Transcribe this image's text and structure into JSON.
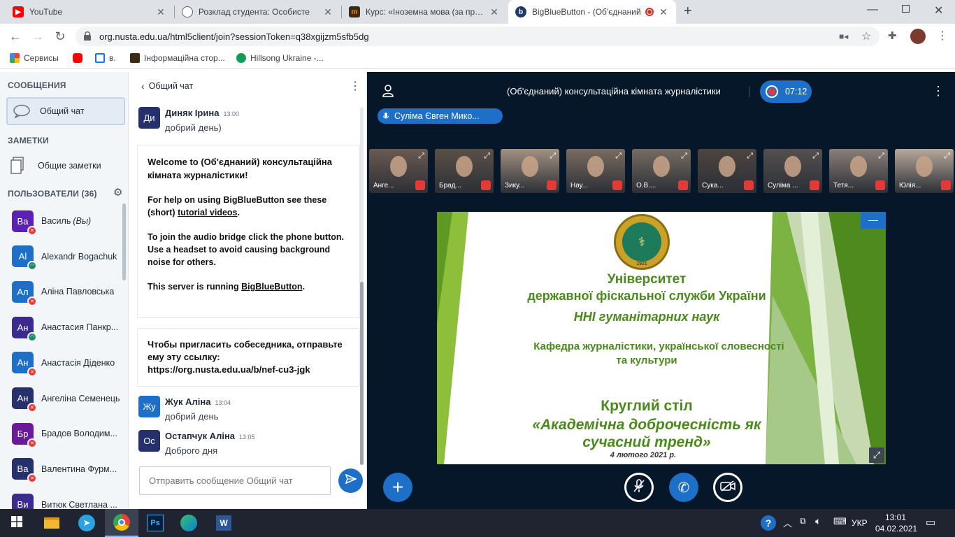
{
  "browser": {
    "tabs": [
      {
        "title": "YouTube",
        "icon": "youtube-icon",
        "color": "#ff0000"
      },
      {
        "title": "Розклад студента: Особисте",
        "icon": "globe-icon",
        "color": "#5f6368"
      },
      {
        "title": "Курс: «Іноземна мова (за профе",
        "icon": "moodle-icon",
        "color": "#f98012"
      },
      {
        "title": "BigBlueButton - (Об'єднаний",
        "icon": "bbb-icon",
        "color": "#1a73e8",
        "active": true
      }
    ],
    "url": "org.nusta.edu.ua/html5client/join?sessionToken=q38xgijzm5sfb5dg",
    "bookmarks": [
      "Сервисы",
      "",
      "в.",
      "Інформаційна стор...",
      "Hillsong Ukraine -..."
    ]
  },
  "sidebar": {
    "messages_heading": "СООБЩЕНИЯ",
    "public_chat": "Общий чат",
    "notes_heading": "ЗАМЕТКИ",
    "shared_notes": "Общие заметки",
    "users_heading": "ПОЛЬЗОВАТЕЛИ (36)",
    "users": [
      {
        "initials": "Ва",
        "name": "Василь",
        "suffix": "(Вы)",
        "color": "#5b21b6",
        "status": "muted"
      },
      {
        "initials": "Al",
        "name": "Alexandr Bogachuk",
        "suffix": "",
        "color": "#1e6fc8",
        "status": "listen"
      },
      {
        "initials": "Ал",
        "name": "Аліна Павловська",
        "suffix": "",
        "color": "#1e6fc8",
        "status": "muted"
      },
      {
        "initials": "Ан",
        "name": "Анастасия Панкр...",
        "suffix": "",
        "color": "#3b2a8f",
        "status": "listen"
      },
      {
        "initials": "Ан",
        "name": "Анастасія Діденко",
        "suffix": "",
        "color": "#1e6fc8",
        "status": "muted"
      },
      {
        "initials": "Ан",
        "name": "Ангеліна Семенець",
        "suffix": "",
        "color": "#25306d",
        "status": "muted"
      },
      {
        "initials": "Бр",
        "name": "Брадов Володим...",
        "suffix": "",
        "color": "#6a1b9a",
        "status": "muted"
      },
      {
        "initials": "Ва",
        "name": "Валентина Фурм...",
        "suffix": "",
        "color": "#25306d",
        "status": "muted"
      },
      {
        "initials": "Ви",
        "name": "Витюк Светлана ...",
        "suffix": "",
        "color": "#3b2a8f",
        "status": "muted"
      }
    ]
  },
  "chat": {
    "title": "Общий чат",
    "messages": [
      {
        "initials": "Ди",
        "name": "Диняк Ірина",
        "time": "13:00",
        "text": "добрий день)",
        "color": "#25306d"
      },
      {
        "initials": "Жу",
        "name": "Жук Аліна",
        "time": "13:04",
        "text": "добрий день",
        "color": "#1e6fc8"
      },
      {
        "initials": "Ос",
        "name": "Остапчук Аліна",
        "time": "13:05",
        "text": "Доброго дня",
        "color": "#25306d"
      }
    ],
    "welcome_prefix": "Welcome to ",
    "welcome_room": "(Об'єднаний) консультаційна кімната журналістики",
    "welcome_suffix": "!",
    "help_text": "For help on using BigBlueButton see these (short) ",
    "help_link": "tutorial videos",
    "audio_text": "To join the audio bridge click the phone button. Use a headset to avoid causing background noise for others.",
    "server_text": "This server is running ",
    "server_link": "BigBlueButton",
    "invite_text": "Чтобы пригласить собеседника, отправьте ему эту ссылку:",
    "invite_link": "https://org.nusta.edu.ua/b/nef-cu3-jgk",
    "input_placeholder": "Отправить сообщение Общий чат"
  },
  "stage": {
    "room_title": "(Об'єднаний) консультаційна кімната журналістики",
    "timer": "07:12",
    "talker": "Суліма Євген Мико...",
    "cameras": [
      {
        "label": "Анге..."
      },
      {
        "label": "Брад..."
      },
      {
        "label": "Зику..."
      },
      {
        "label": "Нау..."
      },
      {
        "label": "О.В...."
      },
      {
        "label": "Сука..."
      },
      {
        "label": "Суліма ..."
      },
      {
        "label": "Тетя..."
      },
      {
        "label": "Юлія..."
      }
    ]
  },
  "slide": {
    "line1": "Університет",
    "line2": "державної фіскальної служби України",
    "line3": "ННІ гуманітарних наук",
    "line4": "Кафедра журналістики, української словесності",
    "line5": "та культури",
    "line6": "Круглий стіл",
    "line7": "«Академічна доброчесність як",
    "line8": "сучасний тренд»",
    "line9": "4 лютого 2021 р.",
    "emblem_year": "1921"
  },
  "taskbar": {
    "lang": "УКР",
    "time": "13:01",
    "date": "04.02.2021"
  }
}
